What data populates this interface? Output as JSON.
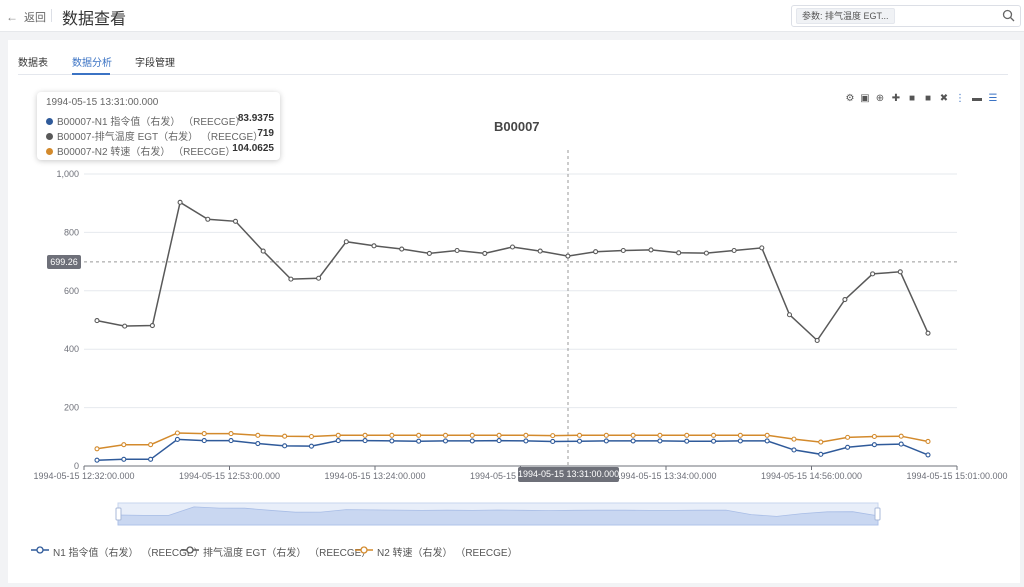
{
  "header": {
    "back_label": "返回",
    "title": "数据查看",
    "search_tag": "参数: 排气温度 EGT..."
  },
  "tabs": [
    {
      "label": "数据表"
    },
    {
      "label": "数据分析"
    },
    {
      "label": "字段管理"
    }
  ],
  "colors": {
    "accent": "#3b73c4",
    "n1": "#2f5a9a",
    "egt": "#595959",
    "n2": "#d38a2c"
  },
  "icons": [
    "gear-icon",
    "camera-icon",
    "zoom-icon",
    "move-icon",
    "plus-box-icon",
    "minus-box-icon",
    "fit-icon",
    "select-icon",
    "back-icon",
    "list-icon"
  ],
  "tooltip": {
    "time": "1994-05-15 13:31:00.000",
    "rows": [
      {
        "label": "B00007-N1 指令值（右发） （REECGE）",
        "value": "83.9375"
      },
      {
        "label": "B00007-排气温度 EGT（右发） （REECGE）",
        "value": "719"
      },
      {
        "label": "B00007-N2 转速（右发） （REECGE）",
        "value": "104.0625"
      }
    ]
  },
  "pointer": {
    "y_value": "699.26",
    "x_value": "1994-05-15 13:31:00.000"
  },
  "chart_data": {
    "type": "line",
    "title": "B00007",
    "ylim": [
      0,
      1000
    ],
    "y_ticks": [
      "0",
      "200",
      "400",
      "600",
      "800",
      "1,000"
    ],
    "x_tick_labels": [
      "1994-05-15 12:32:00.000",
      "1994-05-15 12:53:00.000",
      "1994-05-15 13:24:00.000",
      "1994-05-15 13:31:00.000",
      "1994-05-15 13:34:00.000",
      "1994-05-15 14:56:00.000",
      "1994-05-15 15:01:00.000"
    ],
    "grid": true,
    "legend_position": "bottom-left",
    "series": [
      {
        "name": "N1 指令值（右发） （REECGE）",
        "color": "#2f5a9a",
        "values": [
          20,
          23,
          23,
          91,
          87,
          87,
          77,
          69,
          68,
          87,
          87,
          86,
          85,
          86,
          86,
          87,
          86,
          84,
          85,
          86,
          86,
          86,
          85,
          85,
          86,
          86,
          55,
          40,
          64,
          73,
          75,
          38
        ]
      },
      {
        "name": "排气温度 EGT（右发） （REECGE）",
        "color": "#595959",
        "values": [
          498,
          479,
          481,
          903,
          845,
          838,
          736,
          640,
          643,
          768,
          754,
          743,
          728,
          738,
          728,
          750,
          736,
          719,
          734,
          738,
          740,
          730,
          729,
          738,
          747,
          518,
          430,
          570,
          658,
          665,
          455
        ]
      },
      {
        "name": "N2 转速（右发） （REECGE）",
        "color": "#d38a2c",
        "values": [
          59,
          73,
          73,
          113,
          111,
          111,
          105,
          102,
          101,
          105,
          105,
          105,
          105,
          105,
          105,
          105,
          105,
          104,
          105,
          105,
          105,
          105,
          105,
          105,
          105,
          105,
          92,
          82,
          98,
          101,
          102,
          84
        ]
      }
    ]
  },
  "legend": [
    {
      "label": "N1 指令值（右发） （REECGE）"
    },
    {
      "label": "排气温度 EGT（右发） （REECGE）"
    },
    {
      "label": "N2 转速（右发） （REECGE）"
    }
  ]
}
